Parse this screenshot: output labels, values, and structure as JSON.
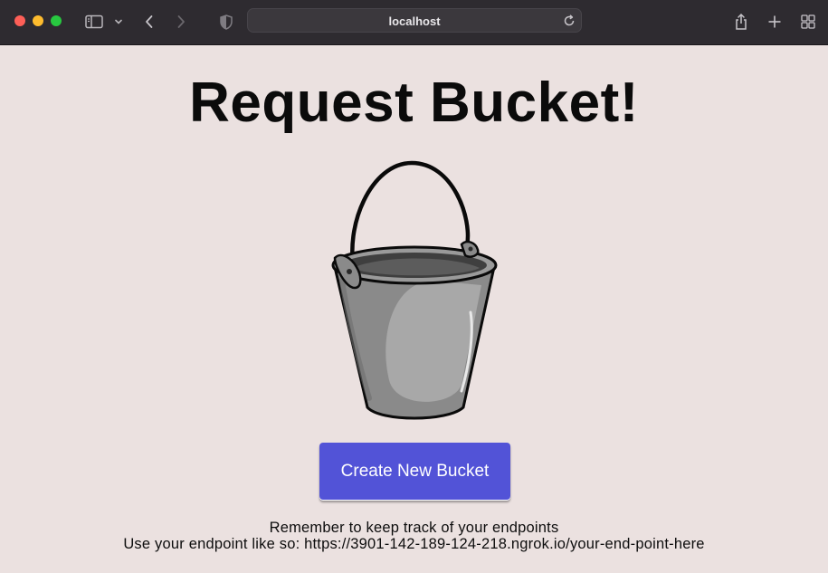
{
  "browser": {
    "url": "localhost",
    "traffic_lights": {
      "close": "#fe5f57",
      "minimize": "#febc2e",
      "zoom": "#28c840"
    },
    "icons": [
      "sidebar-icon",
      "chevron-down-icon",
      "back-icon",
      "forward-icon",
      "shield-icon",
      "reload-icon",
      "share-icon",
      "new-tab-icon",
      "tab-overview-icon"
    ]
  },
  "page": {
    "title": "Request Bucket!",
    "image": "bucket-image",
    "button_label": "Create New Bucket",
    "note_line1": "Remember to keep track of your endpoints",
    "note_line2": "Use your endpoint like so: https://3901-142-189-124-218.ngrok.io/your-end-point-here",
    "colors": {
      "background": "#ebe1e0",
      "button": "#5253d7"
    }
  }
}
